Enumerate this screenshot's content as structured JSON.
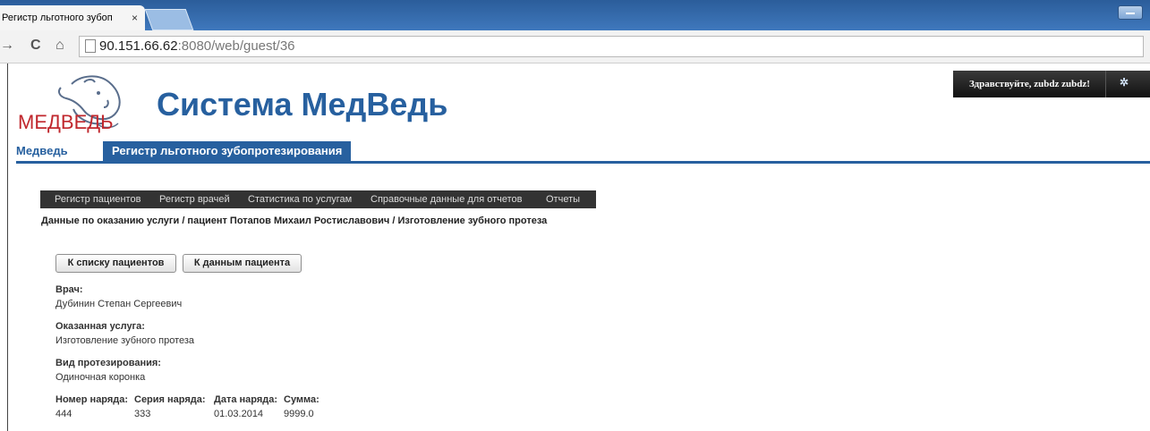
{
  "browser": {
    "tab_title": "Регистр льготного зубоп",
    "tab_close": "×",
    "url_host": "90.151.66.62",
    "url_rest": ":8080/web/guest/36"
  },
  "header": {
    "logo_text": "МЕДВЕДЬ",
    "site_title": "Система МедВедь",
    "greeting": "Здравствуйте, zubdz zubdz!"
  },
  "nav": {
    "items": [
      "Медведь",
      "Регистр льготного зубопротезирования"
    ]
  },
  "subnav": {
    "items": [
      "Регистр пациентов",
      "Регистр врачей",
      "Статистика по услугам",
      "Справочные данные для отчетов",
      "Отчеты"
    ]
  },
  "breadcrumb": "Данные по оказанию услуги / пациент Потапов Михаил Ростиславович / Изготовление зубного протеза",
  "buttons": {
    "to_patients": "К списку пациентов",
    "to_patient_data": "К данным пациента"
  },
  "fields": {
    "doctor_label": "Врач:",
    "doctor_value": "Дубинин Степан Сергеевич",
    "service_label": "Оказанная услуга:",
    "service_value": "Изготовление зубного протеза",
    "prosthesis_label": "Вид протезирования:",
    "prosthesis_value": "Одиночная коронка",
    "order_number_label": "Номер наряда:",
    "order_number_value": "444",
    "order_series_label": "Серия наряда:",
    "order_series_value": "333",
    "order_date_label": "Дата наряда:",
    "order_date_value": "01.03.2014",
    "sum_label": "Сумма:",
    "sum_value": "9999.0"
  }
}
